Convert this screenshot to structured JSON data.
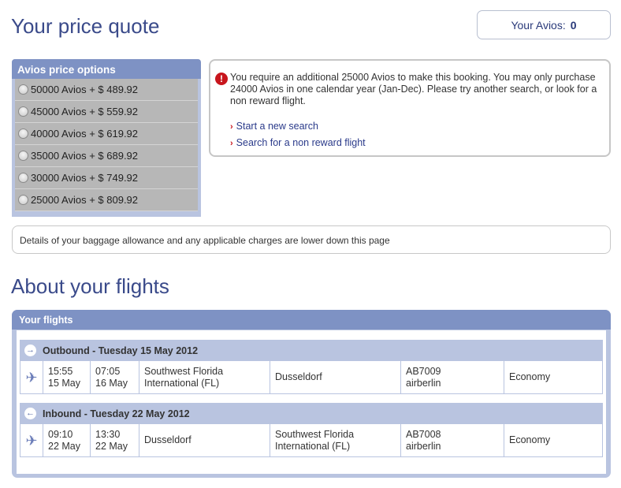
{
  "page_title": "Your price quote",
  "avios_balance": {
    "label": "Your Avios:",
    "value": "0"
  },
  "price_options": {
    "title": "Avios price options",
    "items": [
      "50000 Avios + $ 489.92",
      "45000 Avios + $ 559.92",
      "40000 Avios + $ 619.92",
      "35000 Avios + $ 689.92",
      "30000 Avios + $ 749.92",
      "25000 Avios + $ 809.92"
    ]
  },
  "alert": {
    "message": "You require an additional 25000 Avios to make this booking. You may only purchase 24000 Avios in one calendar year (Jan-Dec). Please try another search, or look for a non reward flight.",
    "links": [
      "Start a new search",
      "Search for a non reward flight"
    ]
  },
  "baggage_note": "Details of your baggage allowance and any applicable charges are lower down this page",
  "section_title": "About your flights",
  "flights": {
    "title": "Your flights",
    "legs": [
      {
        "heading": "Outbound - Tuesday 15 May 2012",
        "dep_time": "15:55",
        "dep_date": "15 May",
        "arr_time": "07:05",
        "arr_date": "16 May",
        "from_line1": "Southwest Florida",
        "from_line2": "International (FL)",
        "to_line1": "Dusseldorf",
        "to_line2": "",
        "flight_no": "AB7009",
        "airline": "airberlin",
        "cabin": "Economy"
      },
      {
        "heading": "Inbound - Tuesday 22 May 2012",
        "dep_time": "09:10",
        "dep_date": "22 May",
        "arr_time": "13:30",
        "arr_date": "22 May",
        "from_line1": "Dusseldorf",
        "from_line2": "",
        "to_line1": "Southwest Florida",
        "to_line2": "International (FL)",
        "flight_no": "AB7008",
        "airline": "airberlin",
        "cabin": "Economy"
      }
    ]
  },
  "icons": {
    "alert": "exclamation-icon",
    "outbound": "arrow-right-icon",
    "inbound": "arrow-left-icon",
    "flight": "plane-icon"
  },
  "colors": {
    "title": "#3a4a8a",
    "panel_header": "#7e92c4",
    "panel_bg": "#b9c4e0",
    "alert_red": "#c8161d"
  }
}
